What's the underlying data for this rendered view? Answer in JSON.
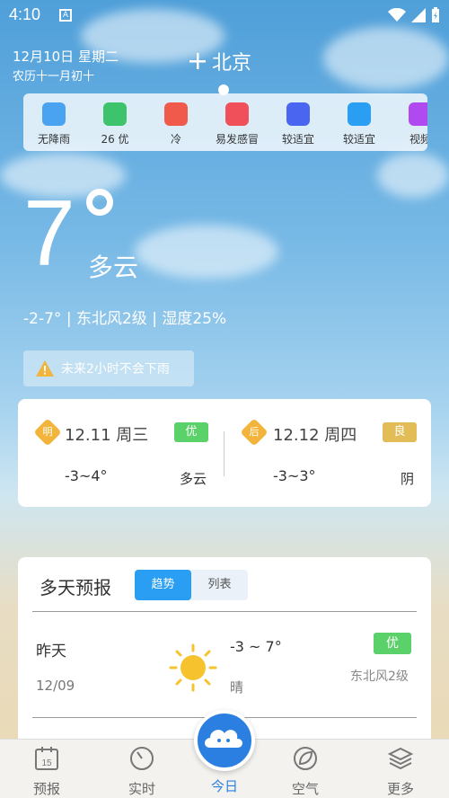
{
  "status": {
    "time": "4:10",
    "notif_letter": "A"
  },
  "header": {
    "date": "12月10日 星期二",
    "lunar": "农历十一月初十",
    "city": "北京"
  },
  "life_index": [
    {
      "label": "无降雨",
      "icon": "raindrop-icon",
      "color": "#4aa3f0"
    },
    {
      "label": "26 优",
      "icon": "leaf-icon",
      "color": "#3cc36b"
    },
    {
      "label": "冷",
      "icon": "shirt-icon",
      "color": "#f05a4a"
    },
    {
      "label": "易发感冒",
      "icon": "medkit-icon",
      "color": "#f0505a"
    },
    {
      "label": "较适宜",
      "icon": "fish-icon",
      "color": "#4a66f0"
    },
    {
      "label": "较适宜",
      "icon": "runner-icon",
      "color": "#2a9ef2"
    },
    {
      "label": "视频",
      "icon": "video-icon",
      "color": "#b04af0"
    }
  ],
  "current": {
    "temp": "7",
    "condition": "多云",
    "range": "-2-7°",
    "wind": "东北风2级",
    "humidity": "湿度25%",
    "alert": "未来2小时不会下雨"
  },
  "days": [
    {
      "tag": "明",
      "date": "12.11 周三",
      "aqi": "优",
      "aqi_color": "#5bd16a",
      "range": "-3~4°",
      "cond": "多云"
    },
    {
      "tag": "后",
      "date": "12.12 周四",
      "aqi": "良",
      "aqi_color": "#e2bd57",
      "range": "-3~3°",
      "cond": "阴"
    }
  ],
  "multi": {
    "title": "多天预报",
    "tab_trend": "趋势",
    "tab_list": "列表",
    "row": {
      "day": "昨天",
      "date": "12/09",
      "range": "-3 ~ 7°",
      "cond": "晴",
      "aqi": "优",
      "wind": "东北风2级"
    }
  },
  "nav": {
    "forecast": "预报",
    "realtime": "实时",
    "today": "今日",
    "air": "空气",
    "more": "更多",
    "calendar_num": "15"
  }
}
